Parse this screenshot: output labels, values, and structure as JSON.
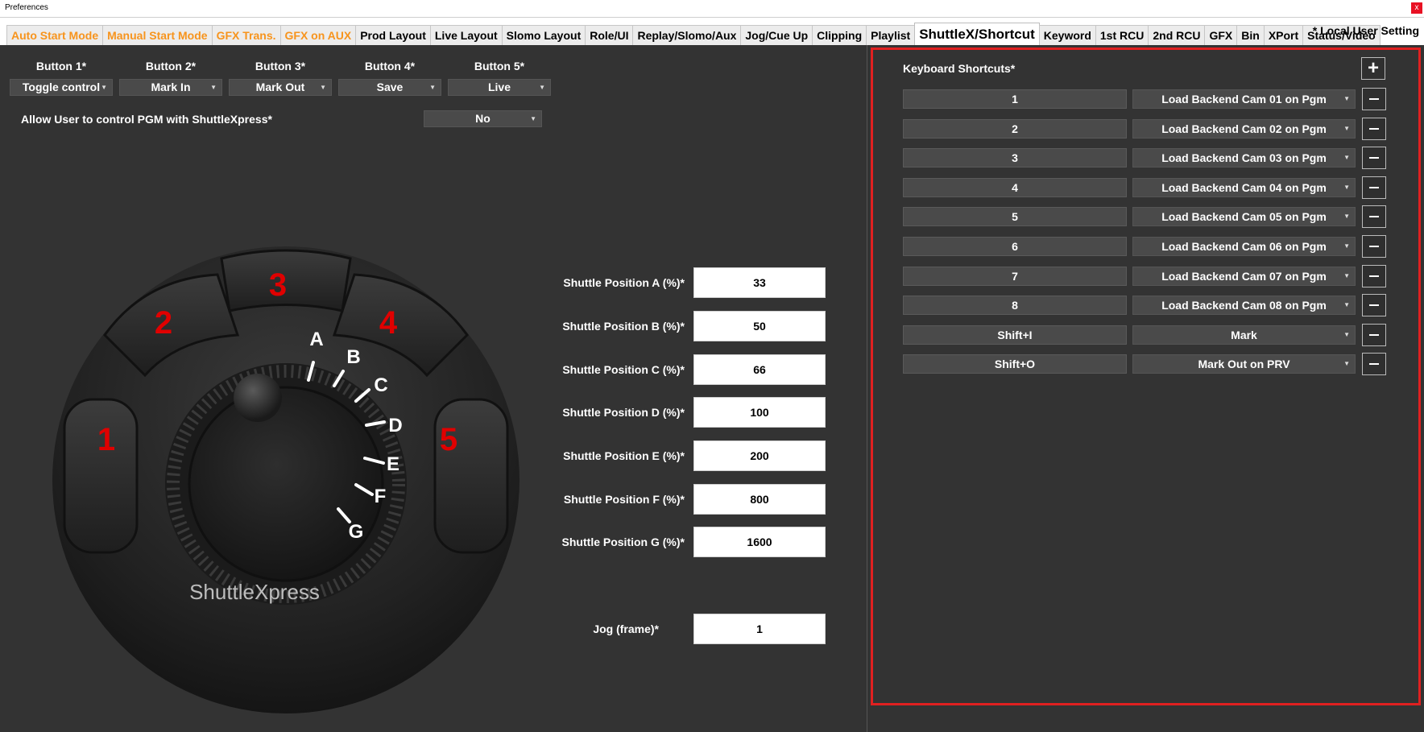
{
  "window": {
    "title": "Preferences",
    "close_glyph": "x"
  },
  "tabs": [
    {
      "label": "Auto Start Mode",
      "style": "orange"
    },
    {
      "label": "Manual Start Mode",
      "style": "orange"
    },
    {
      "label": "GFX Trans.",
      "style": "orange"
    },
    {
      "label": "GFX on AUX",
      "style": "orange"
    },
    {
      "label": "Prod Layout",
      "style": "normal"
    },
    {
      "label": "Live Layout",
      "style": "normal"
    },
    {
      "label": "Slomo Layout",
      "style": "normal"
    },
    {
      "label": "Role/UI",
      "style": "normal"
    },
    {
      "label": "Replay/Slomo/Aux",
      "style": "normal"
    },
    {
      "label": "Jog/Cue Up",
      "style": "normal"
    },
    {
      "label": "Clipping",
      "style": "normal"
    },
    {
      "label": "Playlist",
      "style": "normal"
    },
    {
      "label": "ShuttleX/Shortcut",
      "style": "active"
    },
    {
      "label": "Keyword",
      "style": "normal"
    },
    {
      "label": "1st RCU",
      "style": "normal"
    },
    {
      "label": "2nd RCU",
      "style": "normal"
    },
    {
      "label": "GFX",
      "style": "normal"
    },
    {
      "label": "Bin",
      "style": "normal"
    },
    {
      "label": "XPort",
      "style": "normal"
    },
    {
      "label": "Status/Video",
      "style": "normal"
    }
  ],
  "local_user_setting": "* Local User Setting",
  "buttons": [
    {
      "label": "Button 1*",
      "value": "Toggle control"
    },
    {
      "label": "Button 2*",
      "value": "Mark In"
    },
    {
      "label": "Button 3*",
      "value": "Mark Out"
    },
    {
      "label": "Button 4*",
      "value": "Save"
    },
    {
      "label": "Button 5*",
      "value": "Live"
    }
  ],
  "allow_pgm": {
    "label": "Allow User to control PGM with ShuttleXpress*",
    "value": "No"
  },
  "device": {
    "brand": "ShuttleXpress",
    "button_numbers": [
      "1",
      "2",
      "3",
      "4",
      "5"
    ],
    "position_letters": [
      "A",
      "B",
      "C",
      "D",
      "E",
      "F",
      "G"
    ]
  },
  "shuttle_positions": [
    {
      "label": "Shuttle Position A (%)*",
      "value": "33"
    },
    {
      "label": "Shuttle Position B (%)*",
      "value": "50"
    },
    {
      "label": "Shuttle Position C (%)*",
      "value": "66"
    },
    {
      "label": "Shuttle Position D (%)*",
      "value": "100"
    },
    {
      "label": "Shuttle Position E (%)*",
      "value": "200"
    },
    {
      "label": "Shuttle Position F (%)*",
      "value": "800"
    },
    {
      "label": "Shuttle Position G (%)*",
      "value": "1600"
    }
  ],
  "jog": {
    "label": "Jog (frame)*",
    "value": "1"
  },
  "keyboard_shortcuts": {
    "title": "Keyboard Shortcuts*",
    "add_glyph": "+",
    "rows": [
      {
        "key": "1",
        "action": "Load Backend Cam 01 on Pgm"
      },
      {
        "key": "2",
        "action": "Load Backend Cam 02 on Pgm"
      },
      {
        "key": "3",
        "action": "Load Backend Cam 03 on Pgm"
      },
      {
        "key": "4",
        "action": "Load Backend Cam 04 on Pgm"
      },
      {
        "key": "5",
        "action": "Load Backend Cam 05 on Pgm"
      },
      {
        "key": "6",
        "action": "Load Backend Cam 06 on Pgm"
      },
      {
        "key": "7",
        "action": "Load Backend Cam 07 on Pgm"
      },
      {
        "key": "8",
        "action": "Load Backend Cam 08 on Pgm"
      },
      {
        "key": "Shift+I",
        "action": "Mark"
      },
      {
        "key": "Shift+O",
        "action": "Mark Out on PRV"
      }
    ]
  },
  "colors": {
    "background": "#333333",
    "orange_tab": "#f7941d",
    "button_number_red": "#e00000",
    "highlight_frame": "#e02020"
  }
}
